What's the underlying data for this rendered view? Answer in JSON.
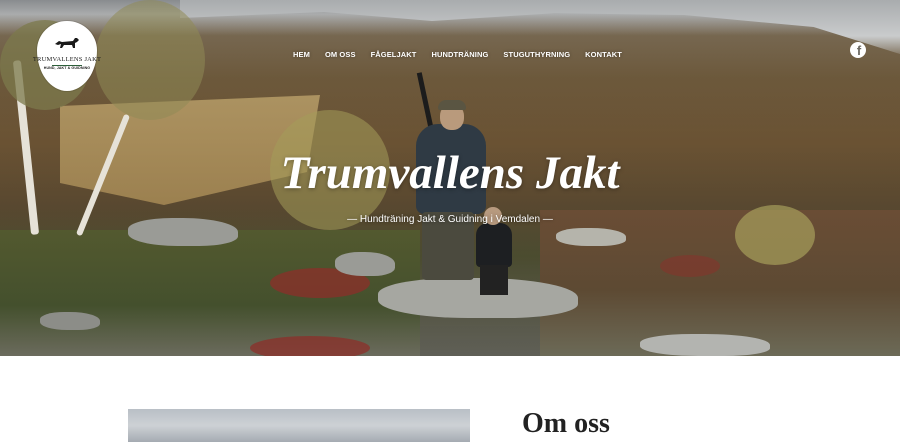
{
  "site": {
    "logo": {
      "name": "TRUMVALLENS JAKT",
      "tagline": "HUND, JAKT & GUIDNING",
      "icon": "dog-icon"
    }
  },
  "nav": {
    "items": [
      {
        "label": "HEM"
      },
      {
        "label": "OM OSS"
      },
      {
        "label": "FÅGELJAKT"
      },
      {
        "label": "HUNDTRÄNING"
      },
      {
        "label": "STUGUTHYRNING"
      },
      {
        "label": "KONTAKT"
      }
    ]
  },
  "social": {
    "facebook_icon": "facebook-icon",
    "glyph": "f"
  },
  "hero": {
    "title": "Trumvallens Jakt",
    "subtitle": "— Hundträning Jakt & Guidning i Vemdalen —"
  },
  "about": {
    "title": "Om oss"
  },
  "colors": {
    "text_light": "#ffffff",
    "heading_dark": "#222222",
    "logo_green": "#2d5f3a"
  }
}
